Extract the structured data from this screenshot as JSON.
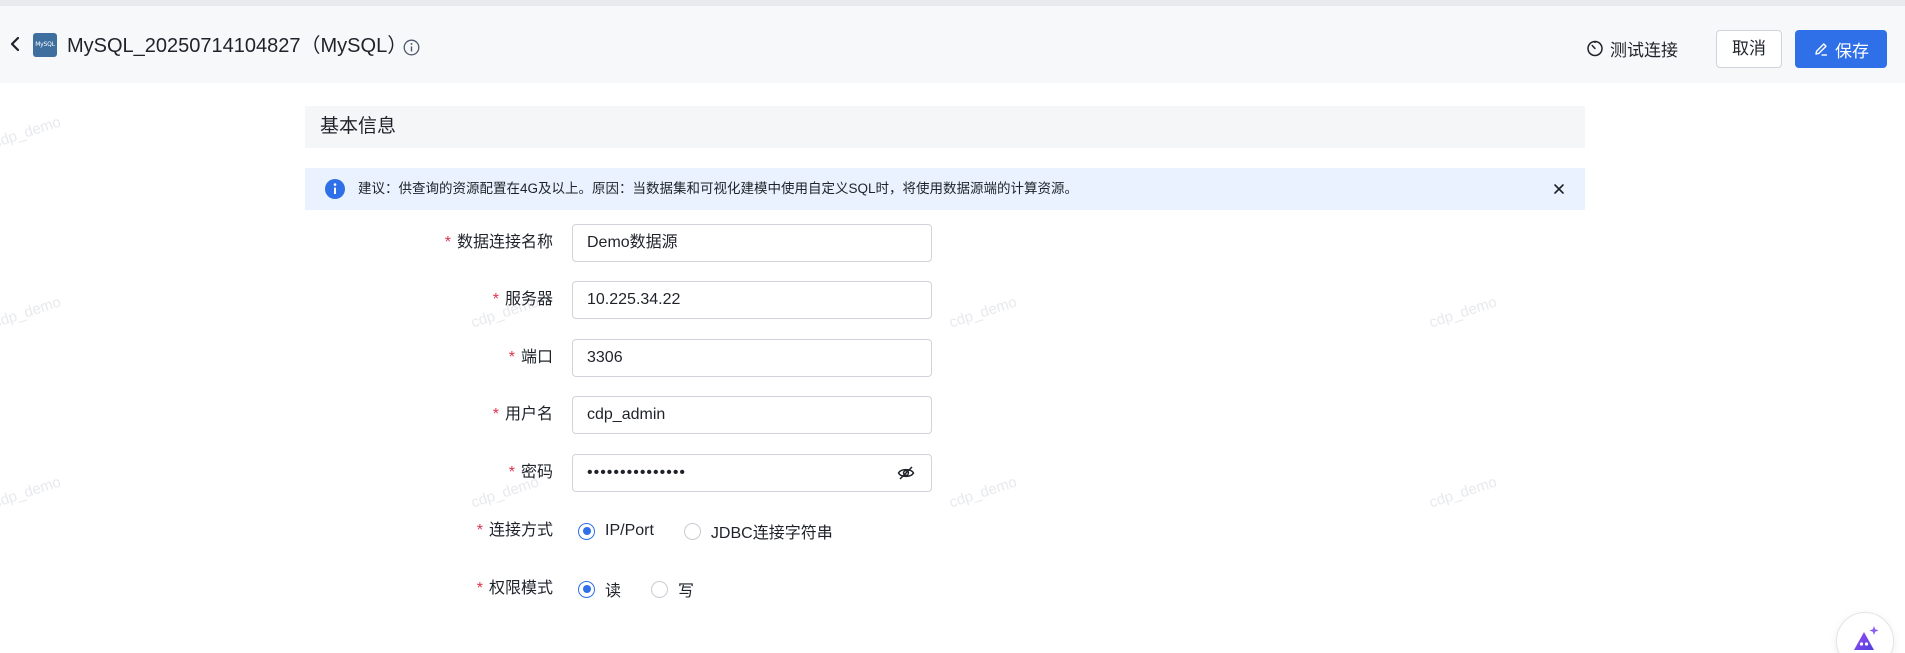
{
  "header": {
    "db_logo_text": "MySQL",
    "title": "MySQL_20250714104827（MySQL）",
    "test_connection_label": "测试连接",
    "cancel_label": "取消",
    "save_label": "保存"
  },
  "watermark": "cdp_demo",
  "section": {
    "title": "基本信息"
  },
  "alert": {
    "text": "建议：供查询的资源配置在4G及以上。原因：当数据集和可视化建模中使用自定义SQL时，将使用数据源端的计算资源。"
  },
  "form": {
    "name": {
      "label": "数据连接名称",
      "value": "Demo数据源"
    },
    "server": {
      "label": "服务器",
      "value": "10.225.34.22"
    },
    "port": {
      "label": "端口",
      "value": "3306"
    },
    "username": {
      "label": "用户名",
      "value": "cdp_admin"
    },
    "password": {
      "label": "密码",
      "value": "•••••••••••••••"
    },
    "connection_mode": {
      "label": "连接方式",
      "options": [
        "IP/Port",
        "JDBC连接字符串"
      ],
      "selected": "IP/Port"
    },
    "permission_mode": {
      "label": "权限模式",
      "options": [
        "读",
        "写"
      ],
      "selected": "读"
    }
  },
  "colors": {
    "primary": "#2f6fe8",
    "required": "#e0334a",
    "alert_bg": "#e9f2fe",
    "header_bg": "#f7f8fa"
  }
}
